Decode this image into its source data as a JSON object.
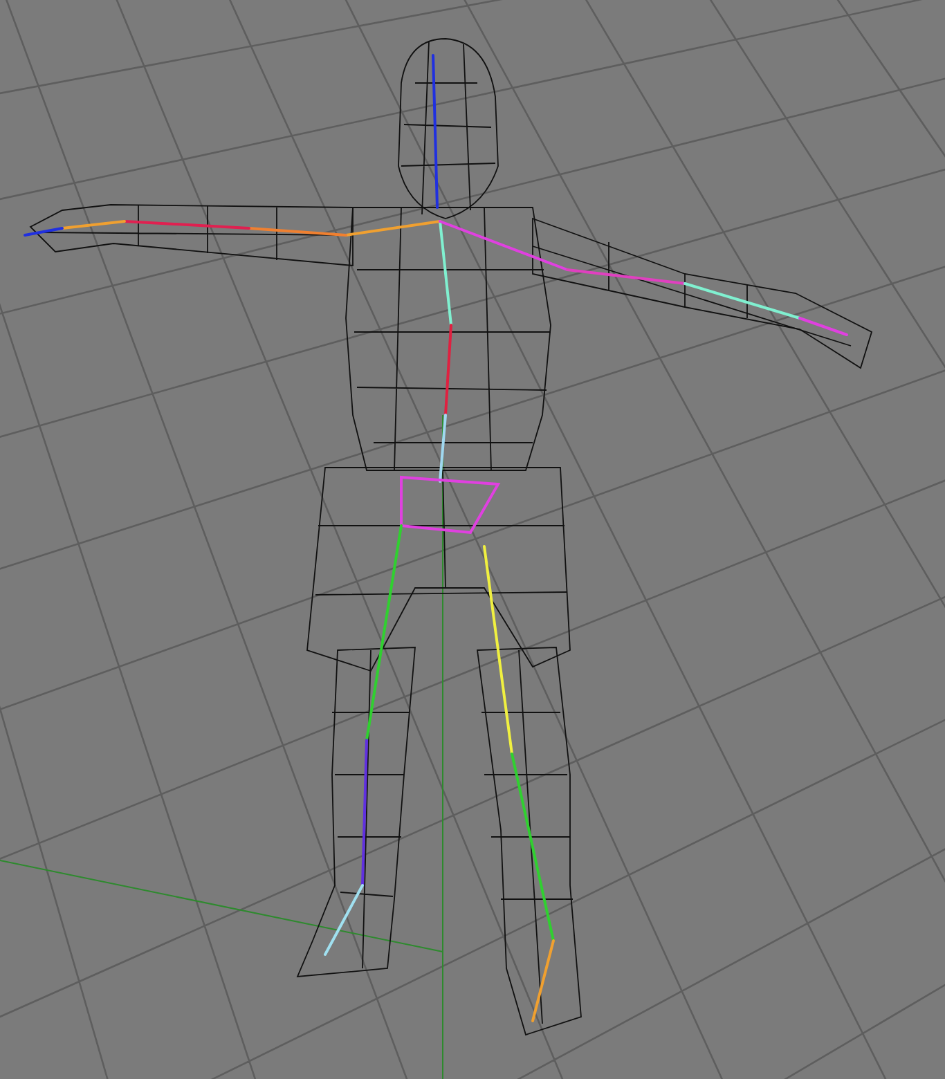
{
  "viewport": {
    "grid": true,
    "axes": true,
    "skeleton": true
  }
}
